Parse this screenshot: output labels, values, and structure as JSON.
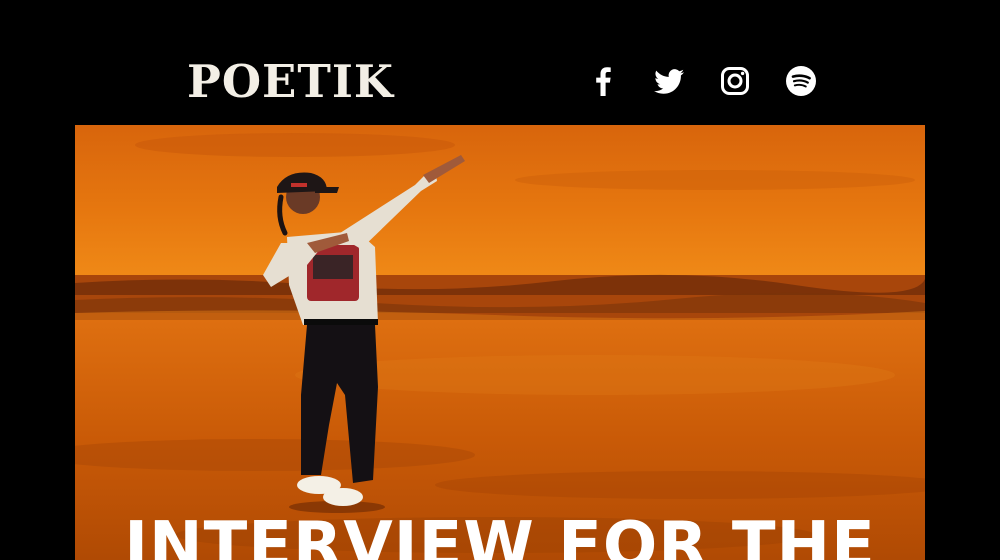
{
  "header": {
    "logo_text": "POETIK",
    "social": [
      {
        "icon": "facebook-icon",
        "label": "Facebook"
      },
      {
        "icon": "twitter-icon",
        "label": "Twitter"
      },
      {
        "icon": "instagram-icon",
        "label": "Instagram"
      },
      {
        "icon": "spotify-icon",
        "label": "Spotify"
      }
    ]
  },
  "hero": {
    "title": "INTERVIEW FOR THE",
    "image_alt": "Artist dabbing on beach at sunset"
  },
  "colors": {
    "background": "#000000",
    "logo": "#f3efe6",
    "icons": "#ffffff",
    "sky": "#e0700f",
    "sand": "#c85a06"
  }
}
